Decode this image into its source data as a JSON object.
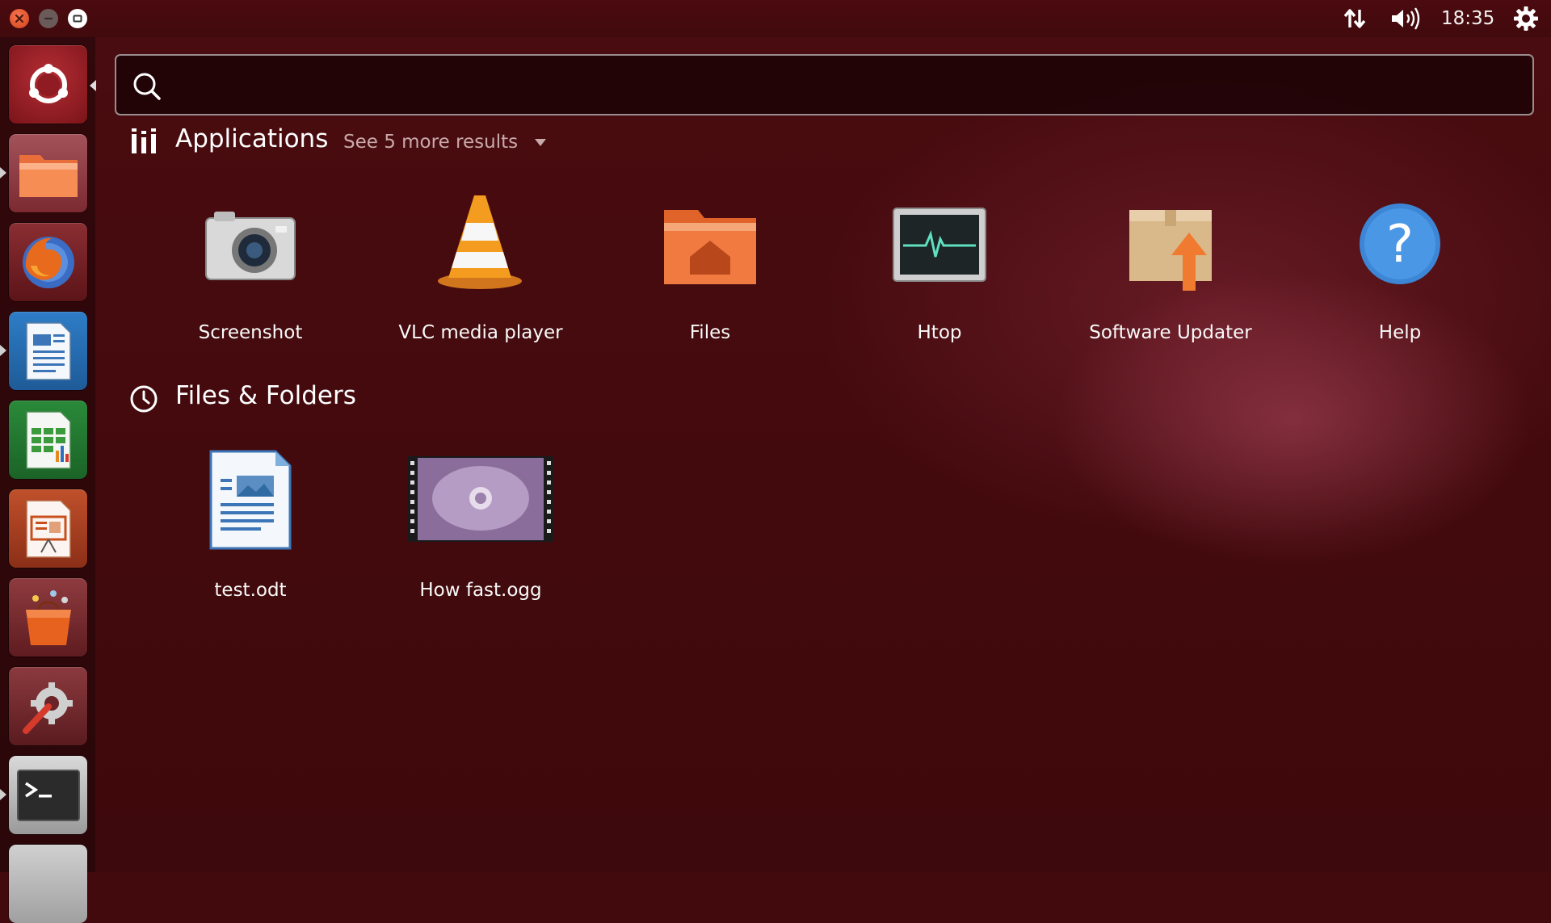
{
  "top_panel": {
    "clock": "18:35",
    "icons": [
      "close-icon",
      "minimize-icon",
      "maximize-icon",
      "network-icon",
      "volume-icon",
      "session-gear-icon"
    ]
  },
  "launcher": {
    "items": [
      {
        "name": "ubuntu-dash",
        "icon": "ubuntu-logo-icon"
      },
      {
        "name": "files",
        "icon": "folder-icon"
      },
      {
        "name": "firefox",
        "icon": "firefox-icon"
      },
      {
        "name": "writer",
        "icon": "writer-icon"
      },
      {
        "name": "calc",
        "icon": "calc-icon"
      },
      {
        "name": "impress",
        "icon": "impress-icon"
      },
      {
        "name": "software-center",
        "icon": "shopping-bag-icon"
      },
      {
        "name": "system-settings",
        "icon": "settings-wrench-icon"
      },
      {
        "name": "terminal",
        "icon": "terminal-icon"
      }
    ]
  },
  "search": {
    "value": "",
    "placeholder": ""
  },
  "applications": {
    "title": "Applications",
    "see_more": "See 5 more results",
    "items": [
      {
        "label": "Screenshot",
        "icon": "camera-icon"
      },
      {
        "label": "VLC media player",
        "icon": "vlc-cone-icon"
      },
      {
        "label": "Files",
        "icon": "home-folder-icon"
      },
      {
        "label": "Htop",
        "icon": "system-monitor-icon"
      },
      {
        "label": "Software Updater",
        "icon": "package-update-icon"
      },
      {
        "label": "Help",
        "icon": "help-icon"
      }
    ]
  },
  "files_folders": {
    "title": "Files & Folders",
    "items": [
      {
        "label": "test.odt",
        "icon": "odt-document-icon"
      },
      {
        "label": "How fast.ogg",
        "icon": "video-thumbnail-icon"
      }
    ]
  },
  "colors": {
    "background": "#430a0e",
    "accent_orange": "#e95420"
  }
}
